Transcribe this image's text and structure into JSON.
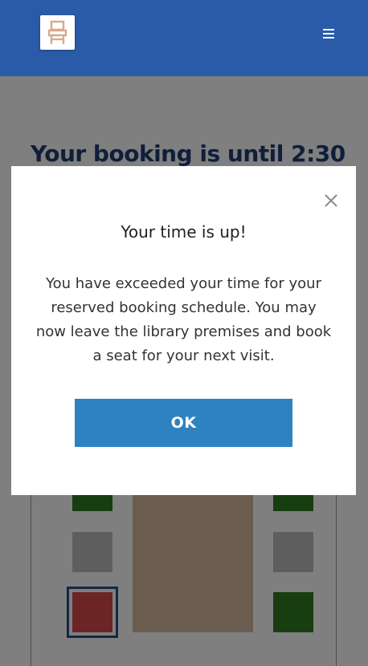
{
  "header": {
    "logo_icon": "chair-icon",
    "menu_icon": "hamburger-menu-icon",
    "background": "#2a5ba8"
  },
  "page": {
    "booking_title": "Your booking is until 2:30"
  },
  "seat_map": {
    "seat_status_colors": {
      "available": "#2f7a22",
      "unavailable": "#bdbdbd",
      "selected": "#d94a4a"
    }
  },
  "modal": {
    "close_icon": "close-icon",
    "title": "Your time is up!",
    "body": "You have exceeded your time for your reserved booking schedule. You may now leave the library premises and book a seat for your next visit.",
    "ok_label": "OK",
    "ok_color": "#2e82bf"
  }
}
